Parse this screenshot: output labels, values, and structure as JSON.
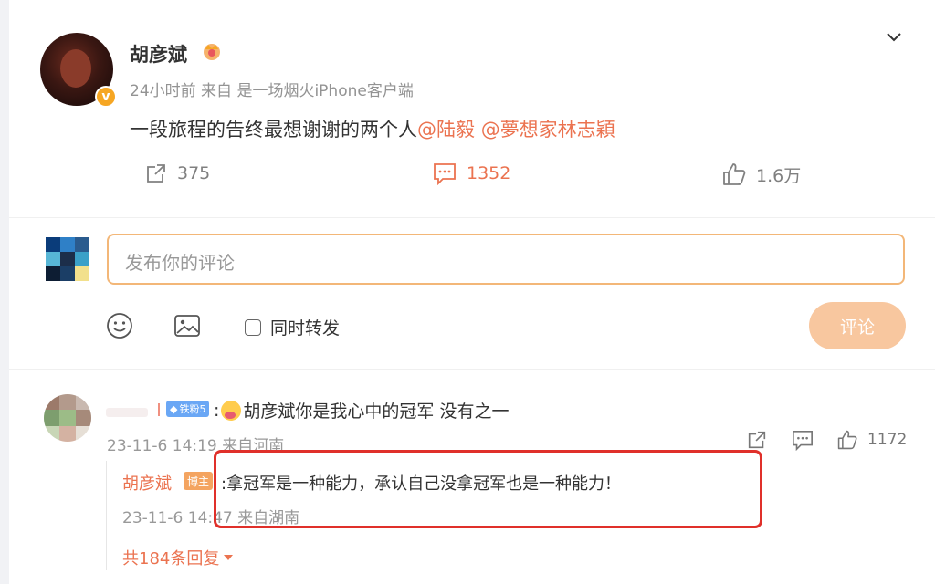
{
  "post": {
    "author": "胡彦斌",
    "meta": "24小时前  来自 是一场烟火iPhone客户端",
    "content_prefix": "一段旅程的告终最想谢谢的两个人",
    "mention_1": "@陆毅",
    "mention_2": "@夢想家林志穎",
    "verified_badge": "v",
    "actions": {
      "repost_count": "375",
      "comment_count": "1352",
      "like_count": "1.6万"
    }
  },
  "composer": {
    "placeholder": "发布你的评论",
    "repost_label": "同时转发",
    "submit_label": "评论"
  },
  "comment": {
    "fan_badge": "铁粉5",
    "text_prefix": ":",
    "text": "胡彦斌你是我心中的冠军  没有之一",
    "meta": "23-11-6 14:19 来自河南",
    "like_count": "1172",
    "reply": {
      "author": "胡彦斌",
      "badge": "博主",
      "text": ":拿冠军是一种能力，承认自己没拿冠军也是一种能力！",
      "meta": "23-11-6 14:47 来自湖南"
    },
    "more_replies": "共184条回复"
  },
  "colors": {
    "accent": "#eb7350",
    "highlight": "#e0302a",
    "submit_bg": "#f8c79f",
    "input_border": "#f3b778"
  },
  "icons": [
    "chevron-down-icon",
    "crown-icon",
    "repost-icon",
    "comment-icon",
    "like-icon",
    "emoji-icon",
    "image-icon",
    "caret-down-icon"
  ]
}
